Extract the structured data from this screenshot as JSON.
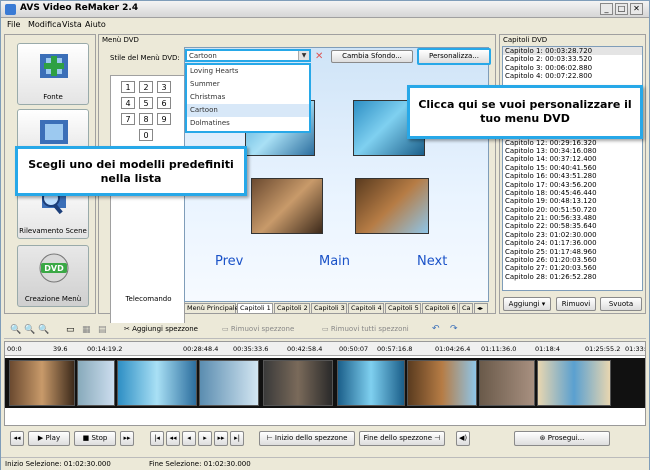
{
  "app": {
    "title": "AVS Video ReMaker 2.4",
    "min": "_",
    "max": "□",
    "close": "✕"
  },
  "menu": [
    "File",
    "Modifica",
    "Vista",
    "Aiuto"
  ],
  "sidebar": {
    "items": [
      {
        "label": "Fonte"
      },
      {
        "label": "Rilevamento Scene"
      },
      {
        "label": "Creazione Menù",
        "badge": "DVD"
      }
    ]
  },
  "menu_panel": {
    "title": "Menù DVD",
    "style_label": "Stile del Menù DVD:",
    "style_value": "Cartoon",
    "dropdown_options": [
      "Loving Hearts",
      "Summer",
      "Christmas",
      "Cartoon",
      "Dolmatines"
    ],
    "change_bg_label": "Cambia Sfondo...",
    "customize_label": "Personalizza...",
    "remote_label": "Telecomando",
    "numpad": [
      "1",
      "2",
      "3",
      "4",
      "5",
      "6",
      "7",
      "8",
      "9",
      "0"
    ],
    "nav": {
      "prev": "Prev",
      "main": "Main",
      "next": "Next"
    },
    "tabs": [
      "Menù Principale",
      "Capitoli 1",
      "Capitoli 2",
      "Capitoli 3",
      "Capitoli 4",
      "Capitoli 5",
      "Capitoli 6",
      "Ca"
    ]
  },
  "callouts": {
    "customize": "Clicca qui se vuoi personalizzare il tuo menu DVD",
    "choose": "Scegli uno dei modelli predefiniti nella lista"
  },
  "chapters_panel": {
    "title": "Capitoli DVD",
    "visible_top": [
      "Capitolo 1:  00:03:28.720",
      "Capitolo 2:  00:03:33.520",
      "Capitolo 3:  00:06:02.880",
      "Capitolo 4:  00:07:22.800"
    ],
    "visible_bottom": [
      "Capitolo 12:  00:29:16.320",
      "Capitolo 13:  00:34:16.080",
      "Capitolo 14:  00:37:12.400",
      "Capitolo 15:  00:40:41.560",
      "Capitolo 16:  00:43:51.280",
      "Capitolo 17:  00:43:56.200",
      "Capitolo 18:  00:45:46.440",
      "Capitolo 19:  00:48:13.120",
      "Capitolo 20:  00:51:50.720",
      "Capitolo 21:  00:56:33.480",
      "Capitolo 22:  00:58:35.640",
      "Capitolo 23:  01:02:30.000",
      "Capitolo 24:  01:17:36.000",
      "Capitolo 25:  01:17:48.960",
      "Capitolo 26:  01:20:03.560",
      "Capitolo 27:  01:20:03.560",
      "Capitolo 28:  01:26:52.280"
    ],
    "add": "Aggiungi",
    "remove": "Rimuovi",
    "clear": "Svuota"
  },
  "edit_toolbar": {
    "add_segment": "Aggiungi spezzone",
    "remove_segment": "Rimuovi spezzone",
    "remove_all": "Rimuovi tutti spezzoni"
  },
  "ruler_labels": [
    "00:0",
    "39.6",
    "00:14:19.2",
    "00:28:48.4",
    "00:35:33.6",
    "00:42:58.4",
    "00:50:07",
    "00:57:16.8",
    "01:04:26.4",
    "01:11:36.0",
    "01:18:4",
    "01:25:55.2",
    "01:33:"
  ],
  "playback": {
    "play": "Play",
    "stop": "Stop",
    "segment_start": "Inizio dello spezzone",
    "segment_end": "Fine dello spezzone",
    "proceed": "Prosegui..."
  },
  "status": {
    "start": "Inizio Selezione: 01:02:30.000",
    "end": "Fine Selezione: 01:02:30.000"
  },
  "colors": {
    "accent": "#27a8e8",
    "nav_text": "#1a52c8",
    "window_bg": "#ece9d8"
  }
}
